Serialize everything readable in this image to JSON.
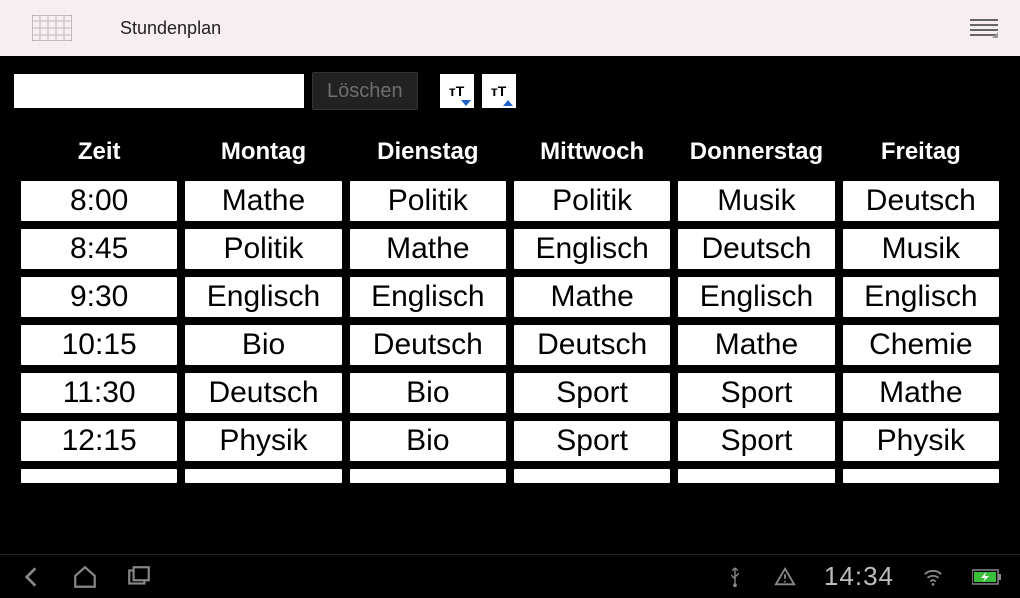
{
  "titlebar": {
    "title": "Stundenplan"
  },
  "toolbar": {
    "search_value": "",
    "delete_label": "Löschen",
    "font_small_label": "тT",
    "font_large_label": "тT"
  },
  "schedule": {
    "headers": [
      "Zeit",
      "Montag",
      "Dienstag",
      "Mittwoch",
      "Donnerstag",
      "Freitag"
    ],
    "rows": [
      [
        "8:00",
        "Mathe",
        "Politik",
        "Politik",
        "Musik",
        "Deutsch"
      ],
      [
        "8:45",
        "Politik",
        "Mathe",
        "Englisch",
        "Deutsch",
        "Musik"
      ],
      [
        "9:30",
        "Englisch",
        "Englisch",
        "Mathe",
        "Englisch",
        "Englisch"
      ],
      [
        "10:15",
        "Bio",
        "Deutsch",
        "Deutsch",
        "Mathe",
        "Chemie"
      ],
      [
        "11:30",
        "Deutsch",
        "Bio",
        "Sport",
        "Sport",
        "Mathe"
      ],
      [
        "12:15",
        "Physik",
        "Bio",
        "Sport",
        "Sport",
        "Physik"
      ],
      [
        "",
        "",
        "",
        "",
        "",
        ""
      ]
    ]
  },
  "navbar": {
    "clock": "14:34"
  }
}
